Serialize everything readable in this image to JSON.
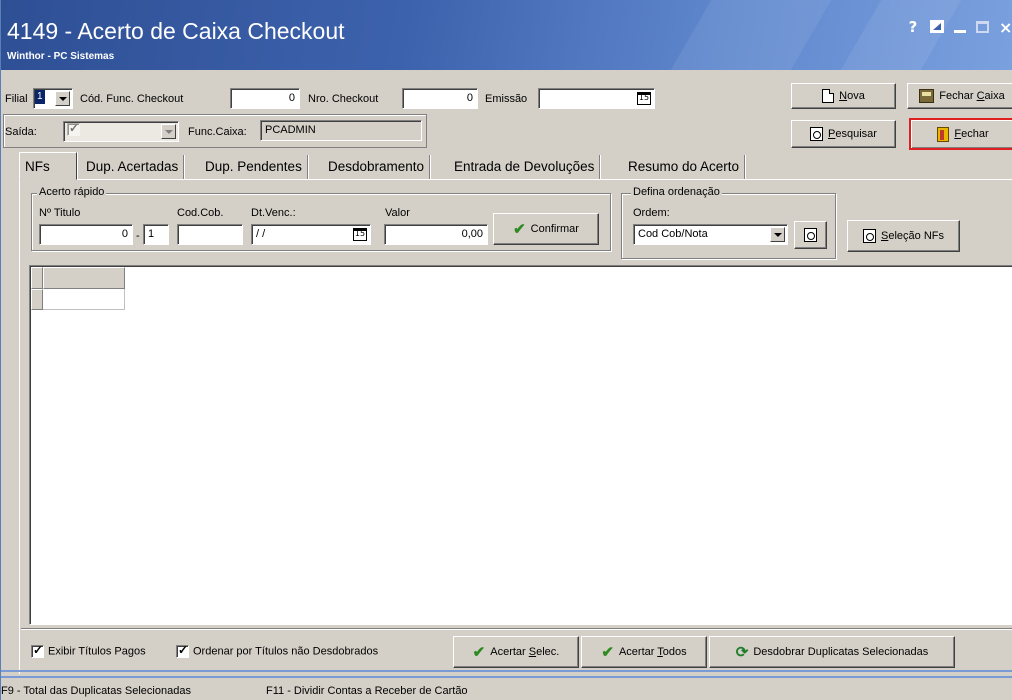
{
  "window": {
    "title": "4149 - Acerto de Caixa Checkout",
    "subtitle": "Winthor - PC Sistemas",
    "controls": {
      "help": "?",
      "close": "×"
    }
  },
  "header": {
    "filial_label": "Filial",
    "filial_value": "1",
    "cod_func_label": "Cód. Func. Checkout",
    "cod_func_value": "0",
    "nro_checkout_label": "Nro. Checkout",
    "nro_checkout_value": "0",
    "emissao_label": "Emissão",
    "emissao_value": "",
    "saida_label": "Saída:",
    "func_caixa_label": "Func.Caixa:",
    "func_caixa_value": "PCADMIN"
  },
  "buttons": {
    "nova_u": "N",
    "nova_rest": "ova",
    "fechar_caixa_pre": "Fechar ",
    "fechar_caixa_u": "C",
    "fechar_caixa_rest": "aixa",
    "pesquisar_u": "P",
    "pesquisar_rest": "esquisar",
    "fechar_u": "F",
    "fechar_rest": "echar"
  },
  "tabs": [
    {
      "label": "NFs"
    },
    {
      "label": "Dup. Acertadas"
    },
    {
      "label": "Dup. Pendentes"
    },
    {
      "label": "Desdobramento"
    },
    {
      "label": "Entrada de Devoluções"
    },
    {
      "label": "Resumo do Acerto"
    }
  ],
  "acerto_rapido": {
    "title": "Acerto rápido",
    "n_titulo_label": "Nº Titulo",
    "n_titulo_value": "0",
    "separator": "-",
    "prest_value": "1",
    "cod_cob_label": "Cod.Cob.",
    "cod_cob_value": "",
    "dt_venc_label": "Dt.Venc.:",
    "dt_venc_value": "/ /",
    "valor_label": "Valor",
    "valor_value": "0,00",
    "confirmar_label": "Confirmar"
  },
  "ordenacao": {
    "title": "Defina ordenação",
    "ordem_label": "Ordem:",
    "ordem_value": "Cod Cob/Nota",
    "selecao_u": "S",
    "selecao_rest": "eleção NFs"
  },
  "footer": {
    "exibir_titulos_pagos": "Exibir Títulos Pagos",
    "ordenar_por": "Ordenar por Títulos não Desdobrados",
    "acertar_selec_pre": "Acertar ",
    "acertar_selec_u": "S",
    "acertar_selec_rest": "elec.",
    "acertar_todos_pre": "Acertar ",
    "acertar_todos_u": "T",
    "acertar_todos_rest": "odos",
    "desdobrar": "Desdobrar Duplicatas Selecionadas"
  },
  "status": {
    "f9": "F9 - Total das Duplicatas Selecionadas",
    "f11": "F11 - Dividir Contas a Receber de Cartão"
  },
  "colors": {
    "titlebar_start": "#2e4f94",
    "titlebar_end": "#7aa0de",
    "face": "#d4d0c8",
    "fechar_border": "#e02020",
    "check_green": "#2e8b22"
  }
}
